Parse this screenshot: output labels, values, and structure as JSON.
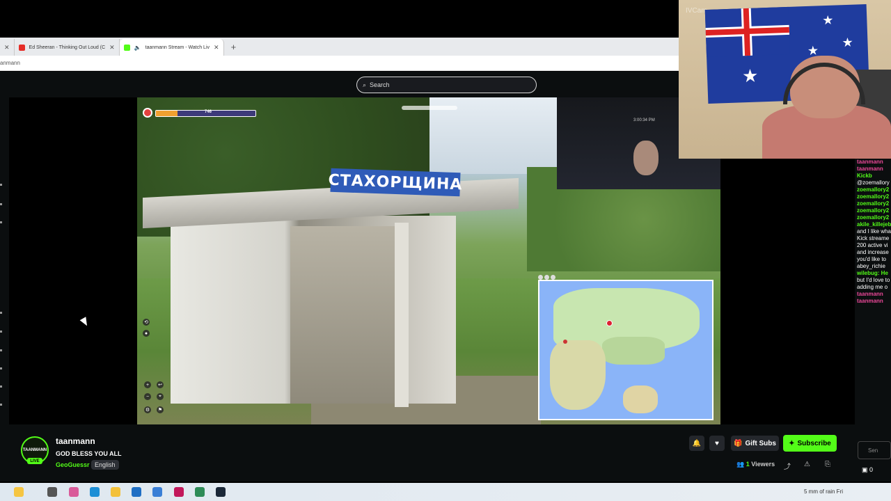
{
  "browser": {
    "tabs": [
      {
        "label": "Ed Sheeran - Thinking Out Loud (C",
        "color": "#e52d27"
      },
      {
        "label": "taanmann Stream - Watch Liv",
        "color": "#53fc18"
      }
    ],
    "address_text": "anmann"
  },
  "search": {
    "placeholder": "Search"
  },
  "game": {
    "sign_text": "СТАХОРЩИНА",
    "hud_score": "746",
    "webcam_time": "3:00:34 PM"
  },
  "overlay_cam": {
    "label": "IVCam"
  },
  "chat": {
    "messages": [
      {
        "type": "pink",
        "text": "taanmann"
      },
      {
        "type": "pink",
        "text": "taanmann"
      },
      {
        "type": "user",
        "text": "Kickb"
      },
      {
        "type": "text",
        "text": "@zoemallory"
      },
      {
        "type": "user",
        "text": "zoemallory2"
      },
      {
        "type": "user",
        "text": "zoemallory2"
      },
      {
        "type": "user",
        "text": "zoemallory2"
      },
      {
        "type": "user",
        "text": "zoemallory2"
      },
      {
        "type": "user",
        "text": "zoemallory2"
      },
      {
        "type": "user",
        "text": "akile_killejeb"
      },
      {
        "type": "text",
        "text": "and I like wha"
      },
      {
        "type": "text",
        "text": "Kick streame"
      },
      {
        "type": "text",
        "text": "200 active vi"
      },
      {
        "type": "text",
        "text": "and increase"
      },
      {
        "type": "text",
        "text": "you'd like to"
      },
      {
        "type": "text",
        "text": "abey_richie"
      },
      {
        "type": "user",
        "text": "wilebug: He"
      },
      {
        "type": "text",
        "text": "but I'd love to"
      },
      {
        "type": "text",
        "text": "adding me o"
      },
      {
        "type": "pink",
        "text": "taanmann"
      },
      {
        "type": "pink",
        "text": "taanmann"
      }
    ],
    "input_placeholder": "Sen",
    "count": "0"
  },
  "stream": {
    "channel": "taanmann",
    "title": "GOD BLESS YOU ALL",
    "category": "GeoGuessr",
    "language": "English",
    "live_label": "LIVE",
    "avatar_text": "TAANMANN",
    "gift_label": "Gift Subs",
    "subscribe_label": "Subscribe",
    "viewers_count": "1",
    "viewers_label": "Viewers"
  },
  "taskbar": {
    "weather": "5 mm of rain Fri"
  },
  "colors": {
    "accent": "#53fc18",
    "background": "#0b0e0f",
    "sign_blue": "#2f5bb8"
  }
}
